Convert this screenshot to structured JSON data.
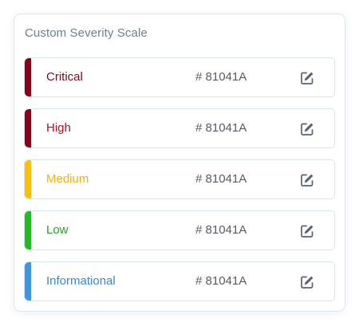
{
  "title": "Custom Severity Scale",
  "levels": [
    {
      "label": "Critical",
      "hex": "# 81041A",
      "color": "#86041a",
      "text_color": "#7f0819"
    },
    {
      "label": "High",
      "hex": "# 81041A",
      "color": "#86041a",
      "text_color": "#b80c1e"
    },
    {
      "label": "Medium",
      "hex": "# 81041A",
      "color": "#fbbf0c",
      "text_color": "#f0b20a"
    },
    {
      "label": "Low",
      "hex": "# 81041A",
      "color": "#22bb22",
      "text_color": "#1fa51f"
    },
    {
      "label": "Informational",
      "hex": "# 81041A",
      "color": "#3f94e4",
      "text_color": "#3a87d2"
    }
  ],
  "edit_icon": "pencil-square-icon"
}
